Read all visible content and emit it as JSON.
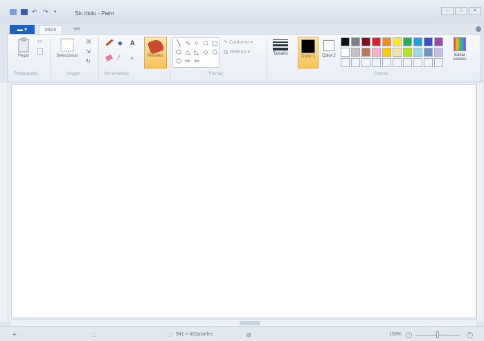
{
  "window": {
    "title": "Sin título - Paint"
  },
  "tabs": {
    "file_label": "",
    "home": "Inicio",
    "view": "Ver"
  },
  "ribbon": {
    "clipboard": {
      "paste": "Pegar",
      "group": "Portapapeles"
    },
    "image": {
      "select": "Seleccionar",
      "group": "Imagen"
    },
    "tools": {
      "group": "Herramientas",
      "text_icon": "A"
    },
    "brushes": {
      "label": "Pinceles"
    },
    "shapes": {
      "outline": "Contorno",
      "fill": "Relleno",
      "group": "Formas"
    },
    "size": {
      "label": "Tamaño"
    },
    "color1": {
      "label": "Color 1"
    },
    "color2": {
      "label": "Color 2"
    },
    "colors": {
      "group": "Colores",
      "edit": "Editar colores"
    }
  },
  "palette": [
    "#111111",
    "#7f7f7f",
    "#8b0a1a",
    "#e52026",
    "#f78b1e",
    "#fbe621",
    "#22b14c",
    "#18a3e8",
    "#3f48cc",
    "#a349a4",
    "#ffffff",
    "#c3c3c3",
    "#b97a57",
    "#ffaec9",
    "#ffc90e",
    "#efe4b0",
    "#b5e61d",
    "#99d9ea",
    "#7092be",
    "#c8bfe7",
    "#f0f3f7",
    "#f0f3f7",
    "#f0f3f7",
    "#f0f3f7",
    "#f0f3f7",
    "#f0f3f7",
    "#f0f3f7",
    "#f0f3f7",
    "#f0f3f7",
    "#f0f3f7"
  ],
  "status": {
    "dimensions": "941 × 462píxeles",
    "zoom": "100%"
  }
}
